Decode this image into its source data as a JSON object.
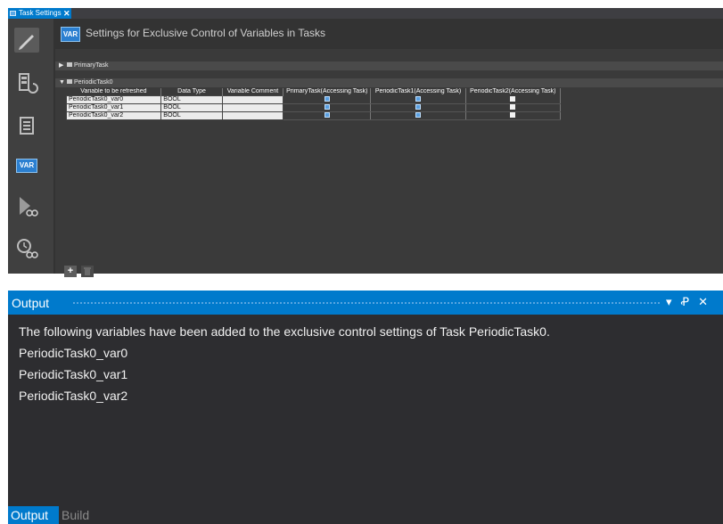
{
  "document_tab": {
    "label": "Task Settings",
    "close_glyph": "✕"
  },
  "left_rail": {
    "items": [
      {
        "icon": "pencil-icon"
      },
      {
        "icon": "io-icon"
      },
      {
        "icon": "list-icon"
      },
      {
        "icon": "var-icon",
        "label": "VAR"
      },
      {
        "icon": "run-glasses-icon"
      },
      {
        "icon": "clock-glasses-icon"
      }
    ]
  },
  "editor": {
    "badge": "VAR",
    "title": "Settings for Exclusive Control of Variables in Tasks",
    "groups": [
      {
        "label": "PrimaryTask",
        "expanded": false
      },
      {
        "label": "PeriodicTask0",
        "expanded": true
      }
    ],
    "columns": [
      "Variable to be refreshed",
      "Data Type",
      "Variable Comment",
      "PrimaryTask(Accessing Task)",
      "PeriodicTask1(Accessing Task)",
      "PeriodicTask2(Accessing Task)"
    ],
    "rows": [
      {
        "variable": "PeriodicTask0_var0",
        "type": "BOOL",
        "comment": "",
        "primary": true,
        "periodic1": true,
        "periodic2": false
      },
      {
        "variable": "PeriodicTask0_var1",
        "type": "BOOL",
        "comment": "",
        "primary": true,
        "periodic1": true,
        "periodic2": false
      },
      {
        "variable": "PeriodicTask0_var2",
        "type": "BOOL",
        "comment": "",
        "primary": true,
        "periodic1": true,
        "periodic2": false
      }
    ],
    "add_button": "+"
  },
  "output": {
    "title": "Output",
    "controls": {
      "dropdown": "▾",
      "pin": "Ꝓ",
      "close": "✕"
    },
    "lines": [
      "The following variables have been added to the exclusive control settings of Task PeriodicTask0.",
      "PeriodicTask0_var0",
      "PeriodicTask0_var1",
      "PeriodicTask0_var2"
    ],
    "tabs": [
      {
        "label": "Output",
        "active": true
      },
      {
        "label": "Build",
        "active": false
      }
    ]
  },
  "colors": {
    "accent": "#007acc",
    "panel_dark": "#2d2d30",
    "check_on": "#5a9fe0"
  }
}
